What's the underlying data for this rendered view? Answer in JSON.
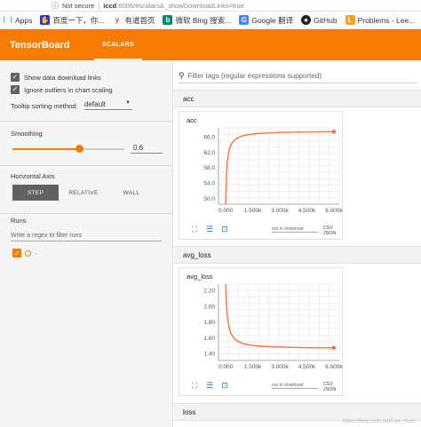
{
  "browser": {
    "security_label": "Not secure",
    "url_host": "iccd",
    "url_rest": ":6006/#scalars&_showDownloadLinks=true",
    "bookmarks": [
      {
        "label": "Apps",
        "icon": "apps-grid-icon",
        "color": "#4285f4"
      },
      {
        "label": "百度一下，你...",
        "icon": "baidu-icon",
        "color": "#2932e1"
      },
      {
        "label": "有道首页",
        "icon": "youdao-icon",
        "color": "#e53935"
      },
      {
        "label": "微软 Bing 搜索...",
        "icon": "bing-icon",
        "color": "#00897b"
      },
      {
        "label": "Google 翻译",
        "icon": "google-translate-icon",
        "color": "#4285f4"
      },
      {
        "label": "GitHub",
        "icon": "github-icon",
        "color": "#222222"
      },
      {
        "label": "Problems - Lee...",
        "icon": "leetcode-icon",
        "color": "#f89f1b"
      }
    ]
  },
  "header": {
    "title": "TensorBoard",
    "tab": "SCALARS",
    "accent_color": "#f57c00"
  },
  "sidebar": {
    "show_download_links": "Show data download links",
    "ignore_outliers": "Ignore outliers in chart scaling",
    "tooltip_sort_label": "Tooltip sorting method:",
    "tooltip_sort_value": "default",
    "smoothing_label": "Smoothing",
    "smoothing_value": "0.6",
    "smoothing_fraction": 0.6,
    "horizontal_axis_label": "Horizontal Axis",
    "axis_options": [
      "STEP",
      "RELATIVE",
      "WALL"
    ],
    "axis_selected": "STEP",
    "runs_label": "Runs",
    "runs_filter_placeholder": "Write a regex to filter runs",
    "run_name": "."
  },
  "main": {
    "filter_placeholder": "Filter tags (regular expressions supported)",
    "categories": [
      {
        "name": "acc"
      },
      {
        "name": "avg_loss"
      },
      {
        "name": "loss"
      }
    ],
    "run_select_label": "run to download",
    "csv_label": "CSV",
    "json_label": "JSON"
  },
  "watermark": "https://blog.csdn.net/Lee_Yuan",
  "chart_data": [
    {
      "type": "line",
      "title": "acc",
      "xticks": [
        "0.000",
        "1.500k",
        "3.000k",
        "4.500k",
        "6.000k"
      ],
      "yticks": [
        "50.0",
        "54.0",
        "58.0",
        "62.0",
        "66.0"
      ],
      "xlim": [
        -400,
        6300
      ],
      "ylim": [
        48.5,
        68.3
      ],
      "series": [
        {
          "color": "#ff7043",
          "x": [
            0,
            50,
            100,
            200,
            300,
            500,
            700,
            1000,
            1500,
            2000,
            3000,
            4000,
            5000,
            6000
          ],
          "y": [
            48.5,
            56.5,
            60.0,
            62.8,
            64.0,
            65.2,
            65.8,
            66.3,
            66.7,
            66.9,
            67.1,
            67.2,
            67.25,
            67.3
          ]
        }
      ]
    },
    {
      "type": "line",
      "title": "avg_loss",
      "xticks": [
        "0.000",
        "1.500k",
        "3.000k",
        "4.500k",
        "6.000k"
      ],
      "yticks": [
        "1.40",
        "1.60",
        "1.80",
        "2.00",
        "2.20"
      ],
      "xlim": [
        -400,
        6300
      ],
      "ylim": [
        1.31,
        2.28
      ],
      "series": [
        {
          "color": "#ff7043",
          "x": [
            0,
            50,
            100,
            200,
            300,
            500,
            700,
            1000,
            1500,
            2000,
            3000,
            4000,
            5000,
            6000
          ],
          "y": [
            2.28,
            2.0,
            1.85,
            1.72,
            1.65,
            1.58,
            1.55,
            1.52,
            1.5,
            1.49,
            1.48,
            1.475,
            1.47,
            1.47
          ]
        }
      ]
    }
  ]
}
